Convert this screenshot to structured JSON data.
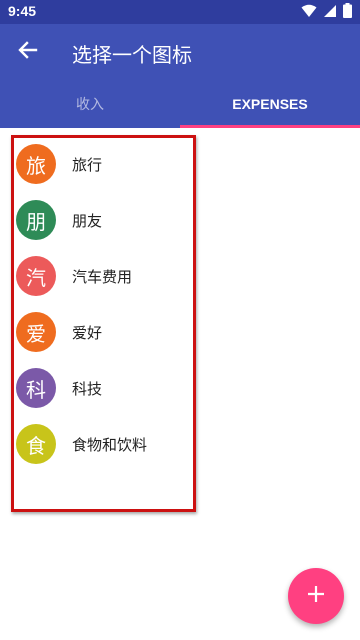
{
  "status_bar": {
    "time": "9:45",
    "icons": [
      "wifi-icon",
      "cellular-signal-icon",
      "battery-icon"
    ]
  },
  "app_bar": {
    "title": "选择一个图标",
    "back_icon": "arrow-back-icon"
  },
  "tabs": [
    {
      "label": "收入",
      "selected": false
    },
    {
      "label": "EXPENSES",
      "selected": true
    }
  ],
  "categories": [
    {
      "icon_char": "旅",
      "label": "旅行",
      "color": "#ef6c1f"
    },
    {
      "icon_char": "朋",
      "label": "朋友",
      "color": "#2e8b57"
    },
    {
      "icon_char": "汽",
      "label": "汽车费用",
      "color": "#ec5a5a"
    },
    {
      "icon_char": "爱",
      "label": "爱好",
      "color": "#ef6c1f"
    },
    {
      "icon_char": "科",
      "label": "科技",
      "color": "#7b59a8"
    },
    {
      "icon_char": "食",
      "label": "食物和饮料",
      "color": "#c8c41a"
    }
  ],
  "fab": {
    "icon": "plus-icon"
  },
  "colors": {
    "primary": "#3f51b5",
    "primary_dark": "#2f3d9e",
    "accent": "#ff4081",
    "highlight_border": "#cc1111"
  }
}
